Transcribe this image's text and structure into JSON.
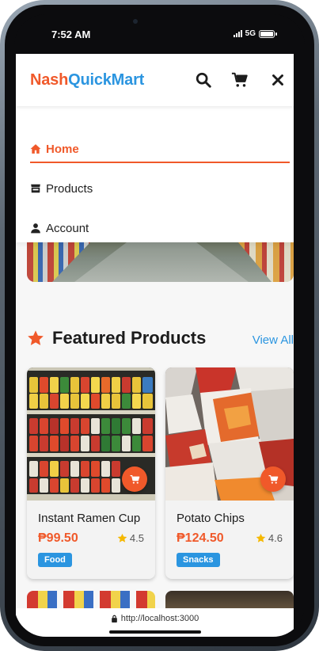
{
  "status_bar": {
    "time": "7:52 AM",
    "network": "5G"
  },
  "header": {
    "logo_part1": "Nash",
    "logo_part2": "QuickMart",
    "icons": [
      "search-icon",
      "cart-icon",
      "close-icon"
    ]
  },
  "nav": {
    "items": [
      {
        "label": "Home",
        "icon": "home-icon",
        "active": true
      },
      {
        "label": "Products",
        "icon": "store-icon",
        "active": false
      },
      {
        "label": "Account",
        "icon": "user-icon",
        "active": false
      }
    ]
  },
  "featured": {
    "title": "Featured Products",
    "view_all": "View All",
    "products": [
      {
        "name": "Instant Ramen Cup",
        "price": "₱99.50",
        "rating": "4.5",
        "category": "Food"
      },
      {
        "name": "Potato Chips",
        "price": "₱124.50",
        "rating": "4.6",
        "category": "Snacks"
      }
    ]
  },
  "browser": {
    "url": "http://localhost:3000"
  },
  "colors": {
    "brand_orange": "#f0592a",
    "brand_blue": "#2b95e0",
    "star": "#f5b800"
  }
}
